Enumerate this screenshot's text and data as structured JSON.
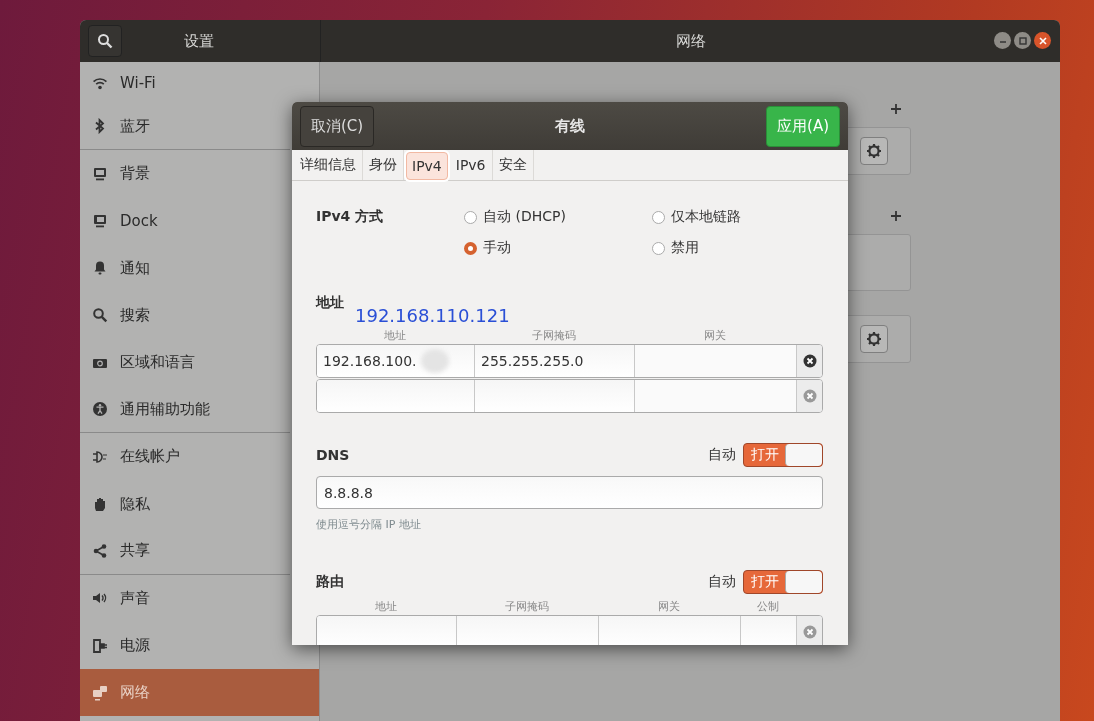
{
  "window": {
    "sidebar_title": "设置",
    "title": "网络"
  },
  "sidebar": {
    "items": [
      {
        "label": "Wi-Fi",
        "selected": false
      },
      {
        "label": "蓝牙",
        "selected": false,
        "divider_after": true
      },
      {
        "label": "背景",
        "selected": false
      },
      {
        "label": "Dock",
        "selected": false
      },
      {
        "label": "通知",
        "selected": false
      },
      {
        "label": "搜索",
        "selected": false
      },
      {
        "label": "区域和语言",
        "selected": false
      },
      {
        "label": "通用辅助功能",
        "selected": false,
        "divider_after": true
      },
      {
        "label": "在线帐户",
        "selected": false
      },
      {
        "label": "隐私",
        "selected": false
      },
      {
        "label": "共享",
        "selected": false,
        "divider_after": true
      },
      {
        "label": "声音",
        "selected": false
      },
      {
        "label": "电源",
        "selected": false
      },
      {
        "label": "网络",
        "selected": true
      }
    ]
  },
  "dialog": {
    "title": "有线",
    "cancel": "取消(C)",
    "apply": "应用(A)",
    "tabs": [
      {
        "label": "详细信息",
        "selected": false
      },
      {
        "label": "身份",
        "selected": false
      },
      {
        "label": "IPv4",
        "selected": true
      },
      {
        "label": "IPv6",
        "selected": false
      },
      {
        "label": "安全",
        "selected": false
      }
    ],
    "method": {
      "label": "IPv4 方式",
      "options": [
        {
          "label": "自动 (DHCP)",
          "selected": false
        },
        {
          "label": "仅本地链路",
          "selected": false
        },
        {
          "label": "手动",
          "selected": true
        },
        {
          "label": "禁用",
          "selected": false
        }
      ]
    },
    "addresses": {
      "heading": "地址",
      "annotation": "192.168.110.121",
      "columns": [
        "地址",
        "子网掩码",
        "网关"
      ],
      "rows": [
        {
          "cells": [
            "192.168.100.",
            "255.255.255.0",
            ""
          ],
          "redacted": true,
          "removable": true
        },
        {
          "cells": [
            "",
            "",
            ""
          ],
          "redacted": false,
          "removable": false
        }
      ]
    },
    "dns": {
      "heading": "DNS",
      "auto_label": "自动",
      "toggle": {
        "label": "打开",
        "on": true
      },
      "value": "8.8.8.8",
      "hint": "使用逗号分隔 IP 地址"
    },
    "routes": {
      "heading": "路由",
      "auto_label": "自动",
      "toggle": {
        "label": "打开",
        "on": true
      },
      "columns": [
        "地址",
        "子网掩码",
        "网关",
        "公制"
      ],
      "rows": [
        {
          "cells": [
            "",
            "",
            "",
            ""
          ],
          "removable": false
        }
      ]
    }
  }
}
